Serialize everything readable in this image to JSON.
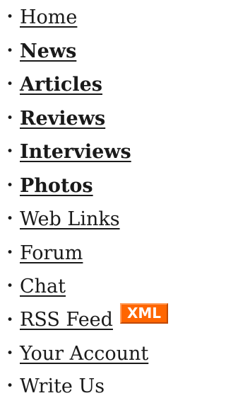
{
  "nav": {
    "items": [
      {
        "label": "Home",
        "bold": false,
        "link": true
      },
      {
        "label": "News",
        "bold": true,
        "link": true
      },
      {
        "label": "Articles",
        "bold": true,
        "link": true
      },
      {
        "label": "Reviews",
        "bold": true,
        "link": true
      },
      {
        "label": "Interviews",
        "bold": true,
        "link": true
      },
      {
        "label": "Photos",
        "bold": true,
        "link": true
      },
      {
        "label": "Web Links",
        "bold": false,
        "link": true
      },
      {
        "label": "Forum",
        "bold": false,
        "link": true
      },
      {
        "label": "Chat",
        "bold": false,
        "link": true
      },
      {
        "label": "RSS Feed",
        "bold": false,
        "link": true,
        "badge": "XML"
      },
      {
        "label": "Your Account",
        "bold": false,
        "link": true
      },
      {
        "label": "Write Us",
        "bold": false,
        "link": false
      }
    ],
    "bullet": "•",
    "badge_color": "#ff6600"
  }
}
